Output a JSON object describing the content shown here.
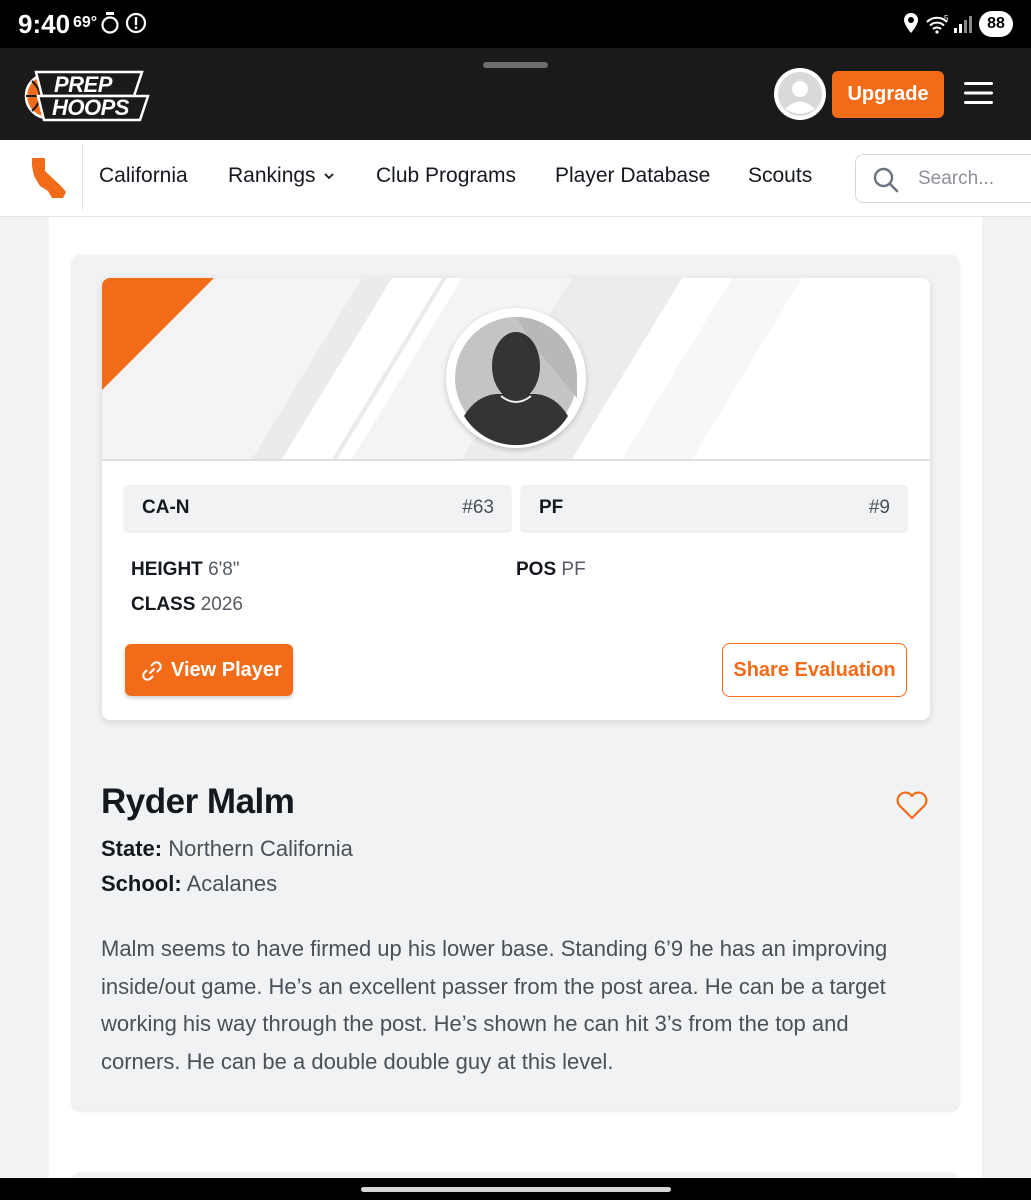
{
  "status_bar": {
    "time": "9:40",
    "temperature": "69°",
    "battery": "88"
  },
  "header": {
    "logo_line1": "PREP",
    "logo_line2": "HOOPS",
    "upgrade_label": "Upgrade"
  },
  "nav": {
    "items": [
      {
        "label": "California"
      },
      {
        "label": "Rankings"
      },
      {
        "label": "Club Programs"
      },
      {
        "label": "Player Database"
      },
      {
        "label": "Scouts"
      }
    ],
    "search_placeholder": "Search..."
  },
  "player_card": {
    "state_rank": {
      "label": "CA-N",
      "value": "#63"
    },
    "position_rank": {
      "label": "PF",
      "value": "#9"
    },
    "height_label": "HEIGHT",
    "height_value": "6'8\"",
    "class_label": "CLASS",
    "class_value": "2026",
    "pos_label": "POS",
    "pos_value": "PF",
    "view_button": "View Player",
    "share_button": "Share Evaluation"
  },
  "evaluation": {
    "player_name": "Ryder Malm",
    "state_label": "State:",
    "state_value": "Northern California",
    "school_label": "School:",
    "school_value": "Acalanes",
    "text": "Malm seems to have firmed up his lower base. Standing 6’9 he has an improving inside/out game. He’s an excellent passer from the post area. He can be a target working his way through the post. He’s shown he can hit 3’s from the top and corners. He can be a double double guy at this level."
  },
  "colors": {
    "accent": "#f26b18",
    "header_bg": "#1a1a1a",
    "text_dark": "#14181f"
  }
}
